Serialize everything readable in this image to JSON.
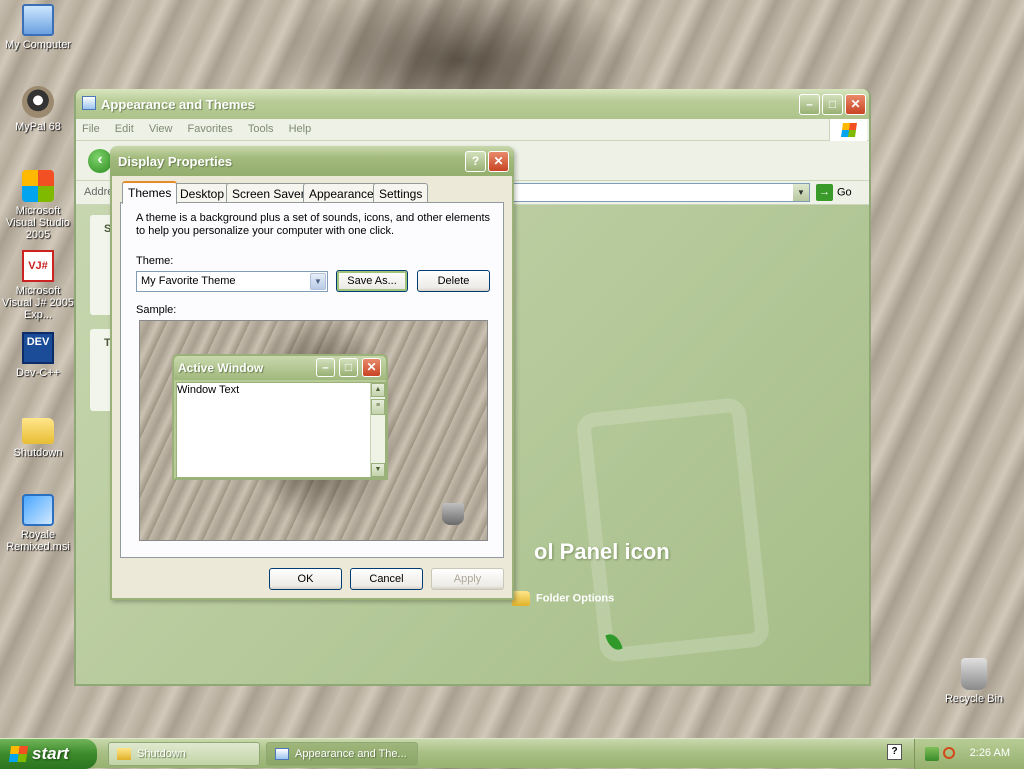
{
  "desktop": {
    "icons": [
      {
        "label": "My Computer",
        "icon": "computer-icon"
      },
      {
        "label": "MyPal 68",
        "icon": "raccoon-icon"
      },
      {
        "label": "Microsoft Visual Studio 2005",
        "icon": "visual-studio-icon"
      },
      {
        "label": "Microsoft Visual J# 2005 Exp...",
        "icon": "vjsharp-icon"
      },
      {
        "label": "Dev-C++",
        "icon": "devcpp-icon"
      },
      {
        "label": "Shutdown",
        "icon": "folder-icon"
      },
      {
        "label": "Royale Remixed.msi",
        "icon": "installer-icon"
      },
      {
        "label": "Recycle Bin",
        "icon": "recycle-bin-icon"
      }
    ],
    "vj_glyph": "VJ#",
    "dev_glyph": "DEV"
  },
  "explorer": {
    "title": "Appearance and Themes",
    "menu": [
      "File",
      "Edit",
      "View",
      "Favorites",
      "Tools",
      "Help"
    ],
    "address_label": "Addre",
    "go_label": "Go",
    "heading_fragment": "ol Panel icon",
    "folder_options": "Folder Options",
    "side_letters": [
      "S",
      "T"
    ]
  },
  "dialog": {
    "title": "Display Properties",
    "help_glyph": "?",
    "close_glyph": "✕",
    "tabs": [
      "Themes",
      "Desktop",
      "Screen Saver",
      "Appearance",
      "Settings"
    ],
    "active_tab": "Themes",
    "description": "A theme is a background plus a set of sounds, icons, and other elements to help you personalize your computer with one click.",
    "theme_label": "Theme:",
    "theme_value": "My Favorite Theme",
    "save_as_label": "Save As...",
    "delete_label": "Delete",
    "sample_label": "Sample:",
    "sample_window_title": "Active Window",
    "sample_window_text": "Window Text",
    "ok_label": "OK",
    "cancel_label": "Cancel",
    "apply_label": "Apply"
  },
  "taskbar": {
    "start_label": "start",
    "tasks": [
      {
        "label": "Shutdown",
        "active": false
      },
      {
        "label": "Appearance and The...",
        "active": true
      }
    ],
    "help_glyph": "?",
    "clock": "2:26 AM"
  },
  "colors": {
    "theme_green": "#a9bf8c",
    "title_green": "#94ae6e",
    "dialog_face": "#ece9d8",
    "tab_accent": "#e68b2c",
    "close_red": "#c84424"
  }
}
